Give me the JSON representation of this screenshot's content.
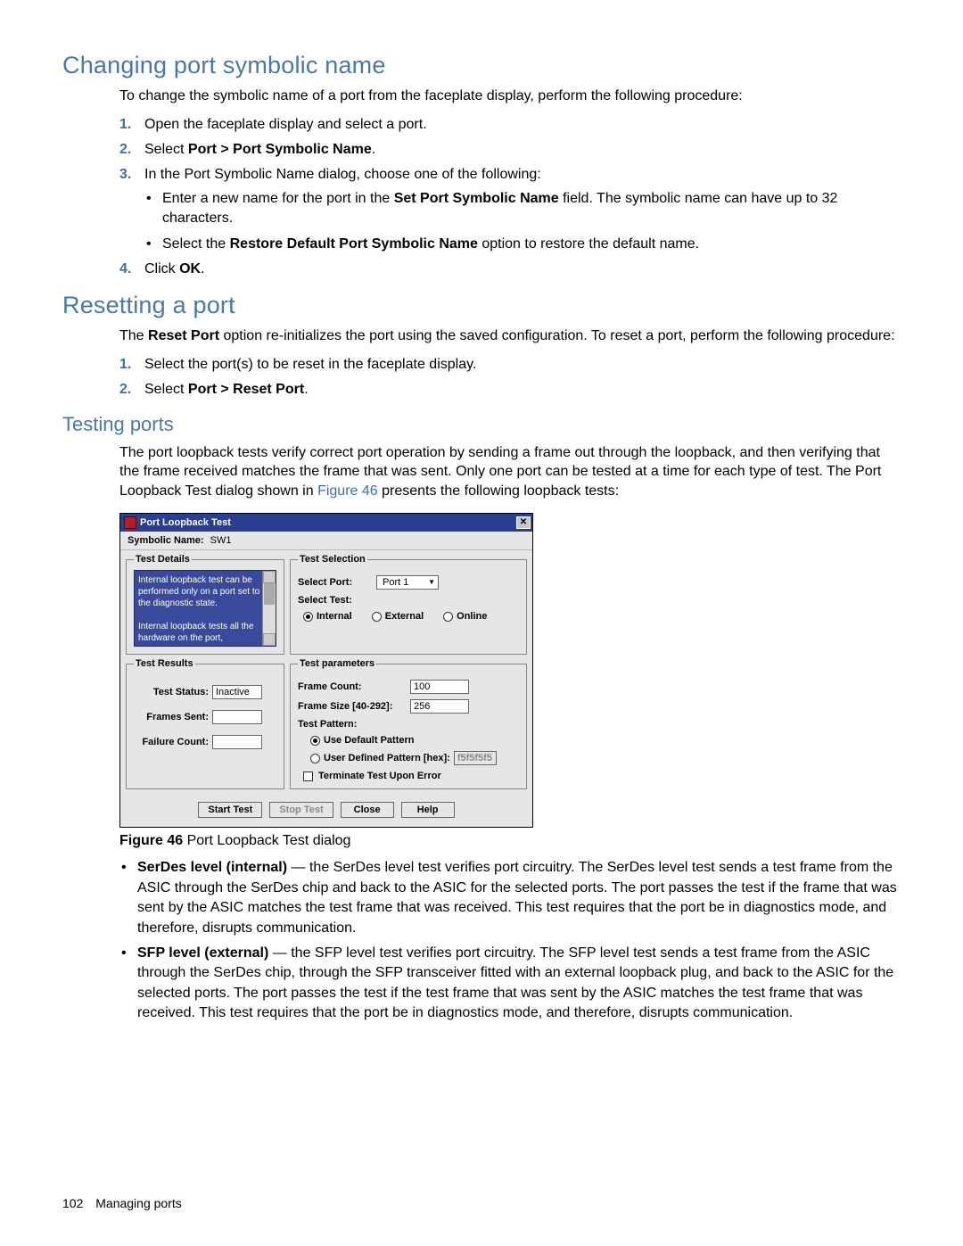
{
  "section1": {
    "heading": "Changing port symbolic name",
    "intro": "To change the symbolic name of a port from the faceplate display, perform the following procedure:",
    "step1": "Open the faceplate display and select a port.",
    "step2_prefix": "Select ",
    "step2_bold": "Port > Port Symbolic Name",
    "step2_suffix": ".",
    "step3": "In the Port Symbolic Name dialog, choose one of the following:",
    "step3_b1a": "Enter a new name for the port in the ",
    "step3_b1b": "Set Port Symbolic Name",
    "step3_b1c": " field. The symbolic name can have up to 32 characters.",
    "step3_b2a": "Select the ",
    "step3_b2b": "Restore Default Port Symbolic Name",
    "step3_b2c": " option to restore the default name.",
    "step4_prefix": "Click ",
    "step4_bold": "OK",
    "step4_suffix": "."
  },
  "section2": {
    "heading": "Resetting a port",
    "intro_a": "The ",
    "intro_b": "Reset Port",
    "intro_c": " option re-initializes the port using the saved configuration. To reset a port, perform the following procedure:",
    "step1": "Select the port(s) to be reset in the faceplate display.",
    "step2_prefix": "Select ",
    "step2_bold": "Port > Reset Port",
    "step2_suffix": "."
  },
  "section3": {
    "heading": "Testing ports",
    "intro_a": "The port loopback tests verify correct port operation by sending a frame out through the loopback, and then verifying that the frame received matches the frame that was sent. Only one port can be tested at a time for each type of test. The Port Loopback Test dialog shown in ",
    "intro_link": "Figure 46",
    "intro_b": " presents the following loopback tests:"
  },
  "dialog": {
    "title": "Port Loopback Test",
    "symname_label": "Symbolic Name:",
    "symname_value": "SW1",
    "grp_details": "Test Details",
    "details_text1": "Internal loopback test can be performed only on a port set to the diagnostic state.",
    "details_text2": "Internal loopback tests all the hardware on the port,",
    "grp_selection": "Test Selection",
    "select_port_label": "Select Port:",
    "select_port_value": "Port 1",
    "select_test_label": "Select Test:",
    "radio_internal": "Internal",
    "radio_external": "External",
    "radio_online": "Online",
    "grp_results": "Test Results",
    "test_status_label": "Test Status:",
    "test_status_value": "Inactive",
    "frames_sent_label": "Frames Sent:",
    "failure_count_label": "Failure Count:",
    "grp_params": "Test parameters",
    "frame_count_label": "Frame Count:",
    "frame_count_value": "100",
    "frame_size_label": "Frame Size [40-292]:",
    "frame_size_value": "256",
    "test_pattern_label": "Test Pattern:",
    "pattern_default": "Use Default Pattern",
    "pattern_user": "User Defined Pattern [hex]:",
    "pattern_user_value": "f5f5f5f5",
    "terminate": "Terminate Test Upon Error",
    "btn_start": "Start Test",
    "btn_stop": "Stop Test",
    "btn_close": "Close",
    "btn_help": "Help"
  },
  "figure": {
    "num": "Figure 46",
    "caption": " Port Loopback Test dialog"
  },
  "descriptions": {
    "d1_bold": "SerDes level (internal)",
    "d1_text": " — the SerDes level test verifies port circuitry. The SerDes level test sends a test frame from the ASIC through the SerDes chip and back to the ASIC for the selected ports. The port passes the test if the frame that was sent by the ASIC matches the test frame that was received. This test requires that the port be in diagnostics mode, and therefore, disrupts communication.",
    "d2_bold": "SFP level (external)",
    "d2_text": " — the SFP level test verifies port circuitry. The SFP level test sends a test frame from the ASIC through the SerDes chip, through the SFP transceiver fitted with an external loopback plug, and back to the ASIC for the selected ports. The port passes the test if the test frame that was sent by the ASIC matches the test frame that was received. This test requires that the port be in diagnostics mode, and therefore, disrupts communication."
  },
  "footer": {
    "page": "102",
    "section": "Managing ports"
  }
}
